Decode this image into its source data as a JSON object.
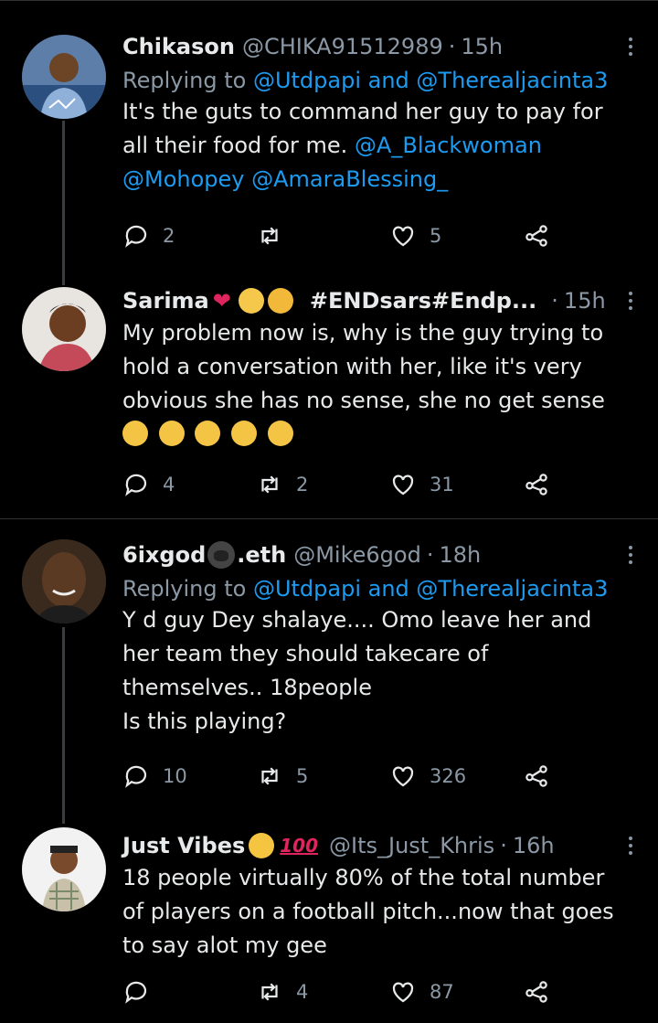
{
  "tweets": [
    {
      "name": "Chikason",
      "handle": "@CHIKA91512989",
      "time": "15h",
      "replying_prefix": "Replying to",
      "replying_to": "@Utdpapi and @Therealjacinta3",
      "body_lines": [
        "It's the guts to command her guy to pay for",
        "all their food for me."
      ],
      "inline_mention": "@A_Blackwoman",
      "mention_line": "@Mohopey @AmaraBlessing_",
      "replies": "2",
      "retweets": "",
      "likes": "5"
    },
    {
      "name": "Sarima",
      "name_suffix": "#ENDsars#Endp...",
      "time": "15h",
      "body_lines": [
        "My problem now is, why is the guy trying to",
        "hold a conversation with her, like it's very",
        "obvious she has no sense, she no get sense"
      ],
      "replies": "4",
      "retweets": "2",
      "likes": "31"
    },
    {
      "name": "6ixgod",
      "name_suffix": ".eth",
      "handle": "@Mike6god",
      "time": "18h",
      "replying_prefix": "Replying to",
      "replying_to": "@Utdpapi and @Therealjacinta3",
      "body_lines": [
        "Y d guy Dey shalaye.... Omo leave her and",
        "her team they should takecare of",
        "themselves.. 18people",
        "Is this playing?"
      ],
      "replies": "10",
      "retweets": "5",
      "likes": "326"
    },
    {
      "name": "Just Vibes",
      "handle": "@Its_Just_Khris",
      "time": "16h",
      "badge": "100",
      "body_lines": [
        "18 people virtually 80% of the total number",
        "of players on a football pitch...now that goes",
        "to say alot my gee"
      ],
      "replies": "",
      "retweets": "4",
      "likes": "87"
    }
  ],
  "colors": {
    "background": "#000000",
    "text": "#e7e9ea",
    "muted": "#8b98a5",
    "link": "#1d9bf0",
    "divider": "#2f3336"
  }
}
